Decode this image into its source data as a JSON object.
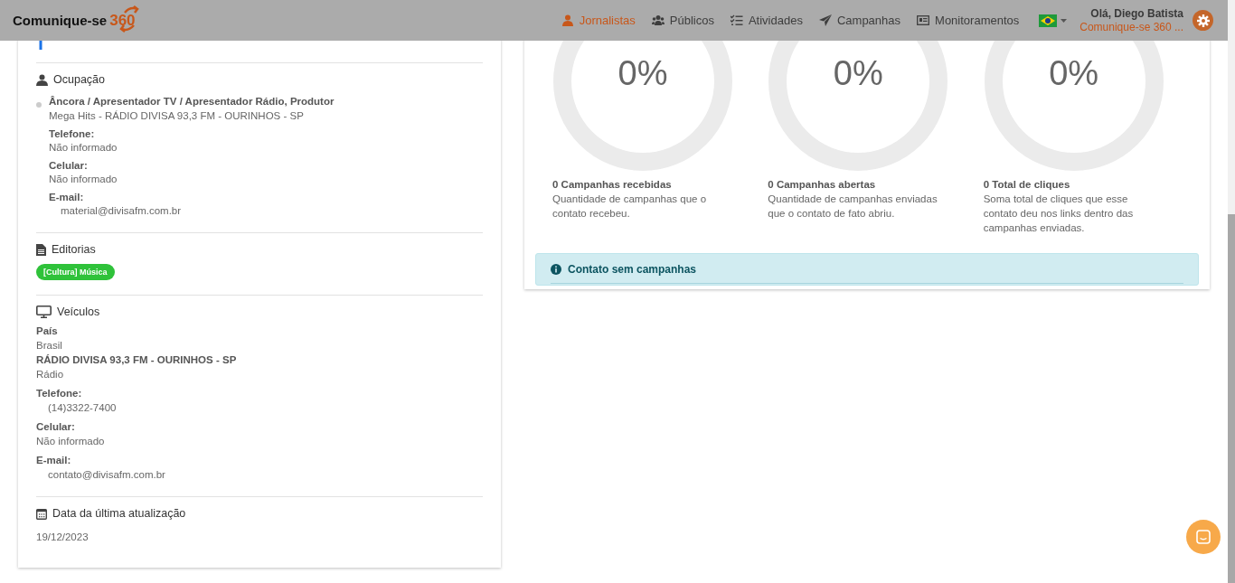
{
  "header": {
    "logo": {
      "name": "Comunique-se",
      "number": "360"
    },
    "nav": [
      {
        "label": "Jornalistas",
        "selected": true
      },
      {
        "label": "Públicos",
        "selected": false
      },
      {
        "label": "Atividades",
        "selected": false
      },
      {
        "label": "Campanhas",
        "selected": false
      },
      {
        "label": "Monitoramentos",
        "selected": false
      }
    ],
    "user": {
      "greeting": "Olá, Diego Batista",
      "account": "Comunique-se 360 ..."
    }
  },
  "profile": {
    "occupation": {
      "title": "Ocupação",
      "role": "Âncora / Apresentador TV / Apresentador Rádio, Produtor",
      "outlet": "Mega Hits - RÁDIO DIVISA 93,3 FM - OURINHOS - SP",
      "fields": [
        {
          "label": "Telefone:",
          "value": "Não informado",
          "indented": false
        },
        {
          "label": "Celular:",
          "value": "Não informado",
          "indented": false
        },
        {
          "label": "E-mail:",
          "value": "material@divisafm.com.br",
          "indented": true
        }
      ]
    },
    "editorials": {
      "title": "Editorias",
      "tags": [
        {
          "label": "[Cultura] Música",
          "color": "#2fc23a"
        }
      ]
    },
    "vehicles": {
      "title": "Veículos",
      "country_label": "País",
      "country": "Brasil",
      "name": "RÁDIO DIVISA 93,3 FM - OURINHOS - SP",
      "type": "Rádio",
      "fields": [
        {
          "label": "Telefone:",
          "value": "(14)3322-7400",
          "indented": true
        },
        {
          "label": "Celular:",
          "value": "Não informado",
          "indented": false
        },
        {
          "label": "E-mail:",
          "value": "contato@divisafm.com.br",
          "indented": true
        }
      ]
    },
    "updated": {
      "title": "Data da última atualização",
      "date": "19/12/2023"
    }
  },
  "stats": [
    {
      "percent": "0%",
      "level": 0,
      "title": "0 Campanhas recebidas",
      "description": "Quantidade de campanhas que o contato recebeu."
    },
    {
      "percent": "0%",
      "level": 0,
      "title": "0 Campanhas abertas",
      "description": "Quantidade de campanhas enviadas que o contato de fato abriu."
    },
    {
      "percent": "0%",
      "level": 0,
      "title": "0 Total de cliques",
      "description": "Soma total de cliques que esse contato deu nos links dentro das campanhas enviadas."
    }
  ],
  "alert": {
    "text": "Contato sem campanhas"
  }
}
